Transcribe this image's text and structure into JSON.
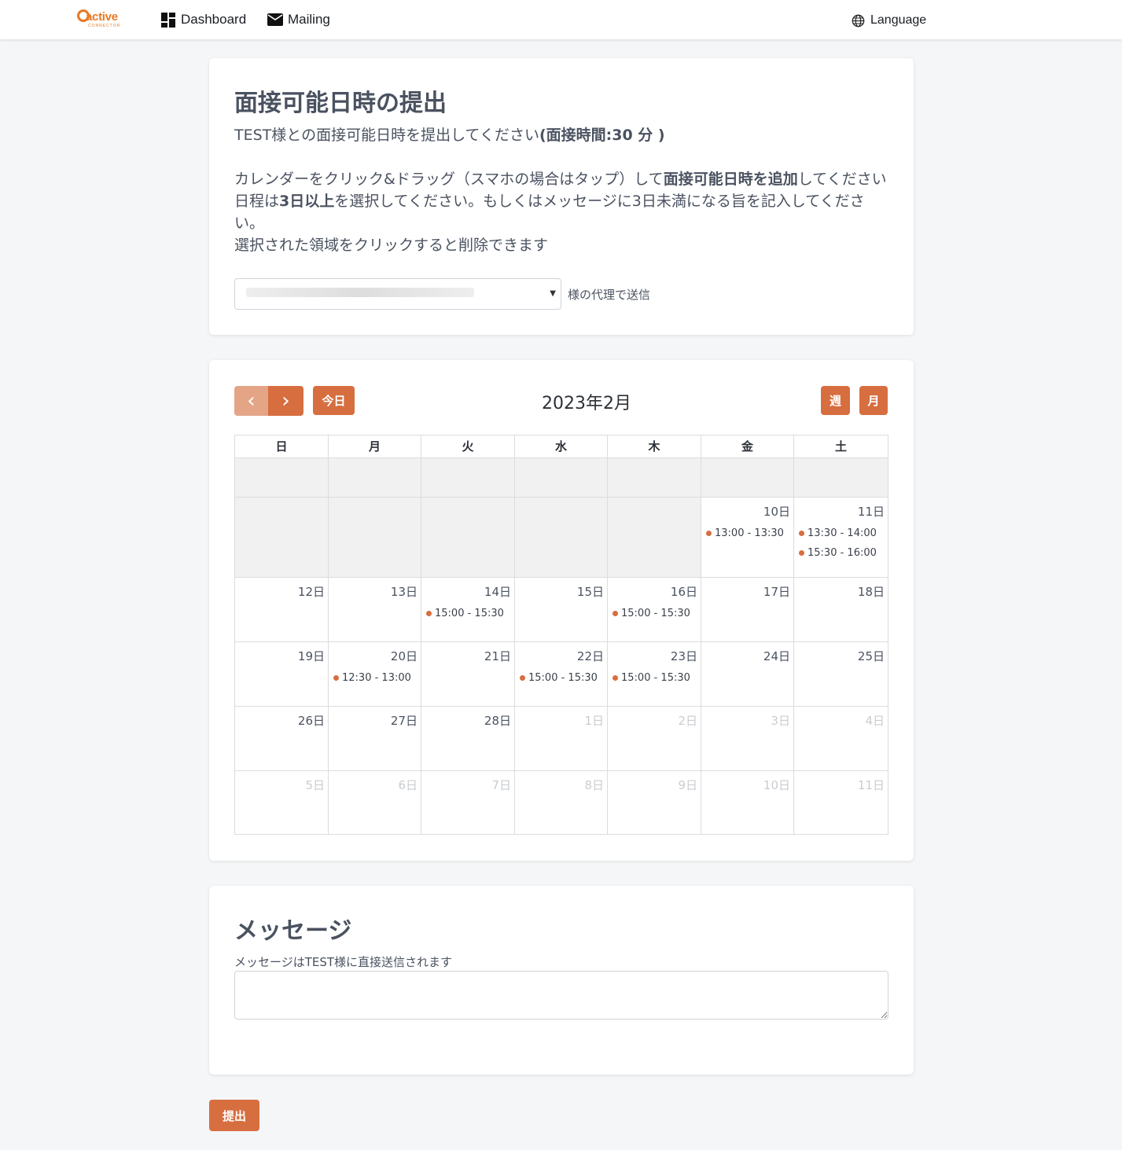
{
  "nav": {
    "logo_text": "active",
    "logo_sub": "CONNECTOR",
    "items": [
      {
        "label": "Dashboard",
        "icon": "dashboard-icon"
      },
      {
        "label": "Mailing",
        "icon": "mail-icon"
      }
    ],
    "language_label": "Language"
  },
  "interview": {
    "title": "面接可能日時の提出",
    "line1_pre": "TEST様との面接可能日時を提出してください",
    "line1_bold": "(面接時間:30 分 )",
    "line2_pre": "カレンダーをクリック&ドラッグ（スマホの場合はタップ）して",
    "line2_bold": "面接可能日時を追加",
    "line2_post": "してください",
    "line3_pre": "日程は",
    "line3_bold": "3日以上",
    "line3_post": "を選択してください。もしくはメッセージに3日未満になる旨を記入してください。",
    "line4": "選択された領域をクリックすると削除できます",
    "proxy_label": "様の代理で送信"
  },
  "calendar": {
    "title": "2023年2月",
    "today_label": "今日",
    "week_label": "週",
    "month_label": "月",
    "prev_glyph": "‹",
    "next_glyph": "›",
    "weekdays": [
      "日",
      "月",
      "火",
      "水",
      "木",
      "金",
      "土"
    ],
    "rows": [
      [
        {
          "day": "",
          "past": true
        },
        {
          "day": "",
          "past": true
        },
        {
          "day": "",
          "past": true
        },
        {
          "day": "",
          "past": true
        },
        {
          "day": "",
          "past": true
        },
        {
          "day": "",
          "past": true
        },
        {
          "day": "",
          "past": true
        }
      ],
      [
        {
          "day": "",
          "past": true
        },
        {
          "day": "",
          "past": true
        },
        {
          "day": "",
          "past": true
        },
        {
          "day": "",
          "past": true
        },
        {
          "day": "",
          "past": true
        },
        {
          "day": "10日",
          "events": [
            "13:00 - 13:30"
          ]
        },
        {
          "day": "11日",
          "events": [
            "13:30 - 14:00",
            "15:30 - 16:00"
          ]
        }
      ],
      [
        {
          "day": "12日"
        },
        {
          "day": "13日"
        },
        {
          "day": "14日",
          "events": [
            "15:00 - 15:30"
          ]
        },
        {
          "day": "15日"
        },
        {
          "day": "16日",
          "events": [
            "15:00 - 15:30"
          ]
        },
        {
          "day": "17日"
        },
        {
          "day": "18日"
        }
      ],
      [
        {
          "day": "19日"
        },
        {
          "day": "20日",
          "events": [
            "12:30 - 13:00"
          ]
        },
        {
          "day": "21日"
        },
        {
          "day": "22日",
          "events": [
            "15:00 - 15:30"
          ]
        },
        {
          "day": "23日",
          "events": [
            "15:00 - 15:30"
          ]
        },
        {
          "day": "24日"
        },
        {
          "day": "25日"
        }
      ],
      [
        {
          "day": "26日"
        },
        {
          "day": "27日"
        },
        {
          "day": "28日"
        },
        {
          "day": "1日",
          "other": true
        },
        {
          "day": "2日",
          "other": true
        },
        {
          "day": "3日",
          "other": true
        },
        {
          "day": "4日",
          "other": true
        }
      ],
      [
        {
          "day": "5日",
          "other": true
        },
        {
          "day": "6日",
          "other": true
        },
        {
          "day": "7日",
          "other": true
        },
        {
          "day": "8日",
          "other": true
        },
        {
          "day": "9日",
          "other": true
        },
        {
          "day": "10日",
          "other": true
        },
        {
          "day": "11日",
          "other": true
        }
      ]
    ]
  },
  "message": {
    "title": "メッセージ",
    "label": "メッセージはTEST様に直接送信されます",
    "value": ""
  },
  "submit_label": "提出",
  "colors": {
    "accent": "#d76e40",
    "accent_disabled": "#e4a587",
    "logo": "#e87722",
    "past_cell": "#f1f1f1"
  }
}
